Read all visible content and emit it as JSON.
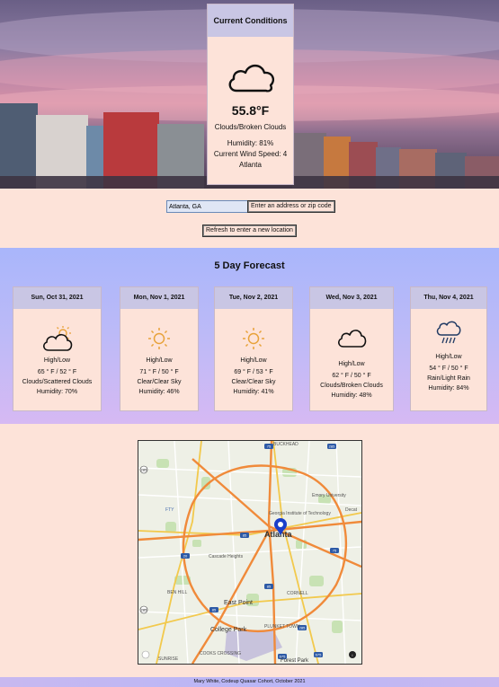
{
  "current": {
    "title": "Current Conditions",
    "temperature": "55.8°F",
    "description": "Clouds/Broken Clouds",
    "humidity": "Humidity: 81%",
    "wind": "Current Wind Speed: 4",
    "location": "Atlanta",
    "icon": "cloud-icon"
  },
  "form": {
    "location_value": "Atlanta, GA",
    "enter_button": "Enter an address or zip code",
    "refresh_button": "Refresh to enter a new location"
  },
  "forecast": {
    "title": "5 Day Forecast",
    "days": [
      {
        "date": "Sun, Oct 31, 2021",
        "icon": "partly-cloudy-icon",
        "label": "High/Low",
        "temps": "65 ° F / 52 ° F",
        "desc": "Clouds/Scattered Clouds",
        "humidity": "Humidity: 70%"
      },
      {
        "date": "Mon, Nov 1, 2021",
        "icon": "sun-icon",
        "label": "High/Low",
        "temps": "71 ° F / 50 ° F",
        "desc": "Clear/Clear Sky",
        "humidity": "Humidity: 46%"
      },
      {
        "date": "Tue, Nov 2, 2021",
        "icon": "sun-icon",
        "label": "High/Low",
        "temps": "69 ° F / 53 ° F",
        "desc": "Clear/Clear Sky",
        "humidity": "Humidity: 41%"
      },
      {
        "date": "Wed, Nov 3, 2021",
        "icon": "cloud-icon",
        "label": "High/Low",
        "temps": "62 ° F / 50 ° F",
        "desc": "Clouds/Broken Clouds",
        "humidity": "Humidity: 48%"
      },
      {
        "date": "Thu, Nov 4, 2021",
        "icon": "rain-icon",
        "label": "High/Low",
        "temps": "54 ° F / 50 ° F",
        "desc": "Rain/Light Rain",
        "humidity": "Humidity: 84%"
      }
    ]
  },
  "map": {
    "labels": {
      "buckhead": "BUCKHEAD",
      "emory": "Emory University",
      "georgia_tech": "Georgia Institute of Technology",
      "atlanta": "Atlanta",
      "decatur": "Decat",
      "fty": "FTY",
      "cascade": "Cascade Heights",
      "ben_hill": "BEN HILL",
      "east_point": "East Point",
      "cornell": "CORNELL",
      "college_park": "College Park",
      "plunket": "PLUNKET TOWN",
      "forest_park": "Forest Park",
      "sunrise": "SUNRISE",
      "cooks": "COOKS CROSSING"
    },
    "shields": [
      "75",
      "285",
      "285",
      "20",
      "85",
      "75",
      "85",
      "285",
      "285",
      "675",
      "85",
      "675",
      "166",
      "85",
      "285",
      "285"
    ]
  },
  "footer": {
    "text": "Mary White, Codeup Quasar Cohort, October 2021"
  },
  "colors": {
    "page_bg": "#fde3d9",
    "card_header": "#c9c6e4",
    "forecast_bg": "#b4b8f8",
    "map_pin": "#1a3fc9"
  }
}
